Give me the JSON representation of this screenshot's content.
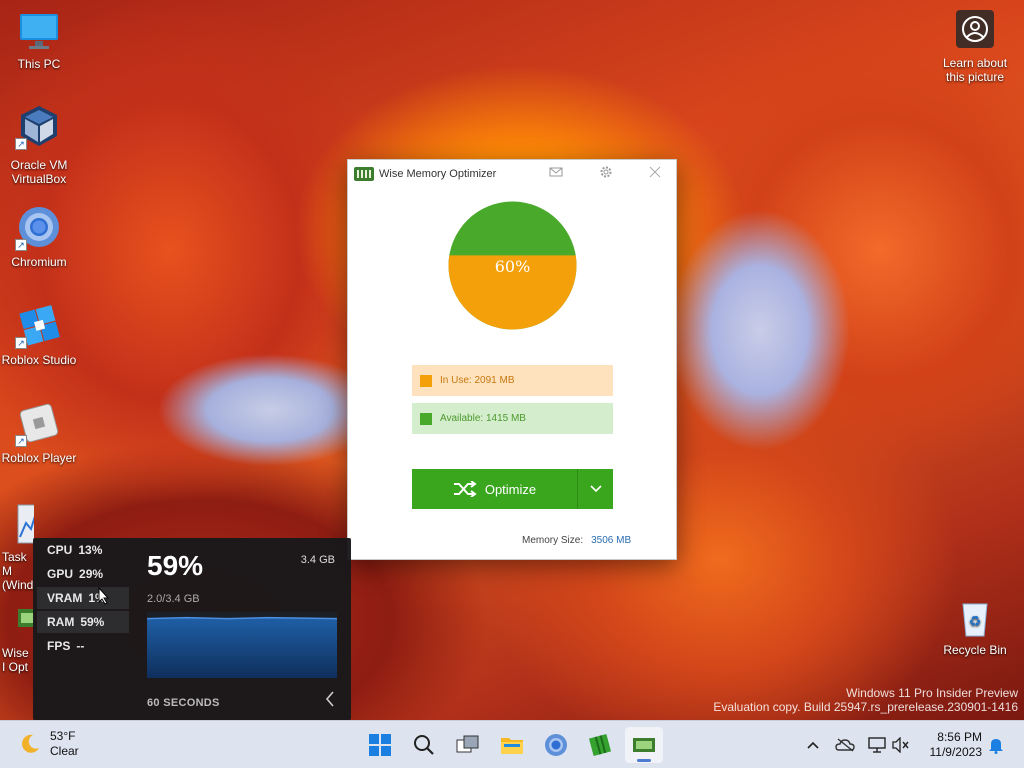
{
  "desktop": {
    "icons": [
      {
        "label": "This PC"
      },
      {
        "label": "Oracle VM VirtualBox"
      },
      {
        "label": "Chromium"
      },
      {
        "label": "Roblox Studio"
      },
      {
        "label": "Roblox Player"
      },
      {
        "label": "Task M (Wind"
      },
      {
        "label": "Wise I Opt"
      }
    ],
    "learn_about": "Learn about this picture",
    "recycle_bin": "Recycle Bin",
    "watermark_line1": "Windows 11 Pro Insider Preview",
    "watermark_line2": "Evaluation copy. Build 25947.rs_prerelease.230901-1416"
  },
  "wmo": {
    "title": "Wise Memory Optimizer",
    "percent_label": "60%",
    "in_use_label": "In Use: 2091 MB",
    "available_label": "Available: 1415 MB",
    "optimize_label": "Optimize",
    "memory_size_label": "Memory Size:",
    "memory_size_value": "3506 MB",
    "in_use_fraction": 0.6,
    "colors": {
      "in_use": "#f4a00a",
      "available": "#48a92b",
      "button": "#3aa61d"
    }
  },
  "perf": {
    "rows": [
      {
        "name": "CPU",
        "value": "13%"
      },
      {
        "name": "GPU",
        "value": "29%"
      },
      {
        "name": "VRAM",
        "value": "1%"
      },
      {
        "name": "RAM",
        "value": "59%"
      },
      {
        "name": "FPS",
        "value": "--"
      }
    ],
    "big_value": "59%",
    "total": "3.4 GB",
    "sub": "2.0/3.4 GB",
    "seconds": "60 SECONDS",
    "ram_fraction": 0.59
  },
  "taskbar": {
    "temp": "53°F",
    "condition": "Clear",
    "time": "8:56 PM",
    "date": "11/9/2023"
  }
}
